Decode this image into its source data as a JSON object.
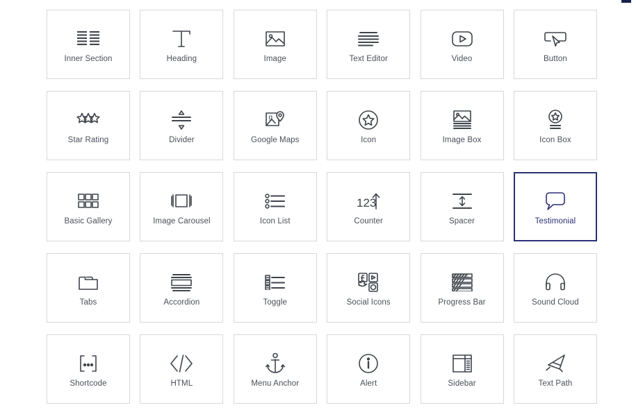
{
  "panel": {
    "title": "Elementor Widgets Panel",
    "background_color": "#ffffff",
    "card_border_color": "#d5d8dc",
    "selected_border_color": "#2b2f77",
    "icon_color": "#3f444b",
    "label_color": "#4a4f58",
    "corner_mark_color": "#18214d"
  },
  "widgets": [
    {
      "label": "Inner Section",
      "icon": "inner-section-icon",
      "selected": false
    },
    {
      "label": "Heading",
      "icon": "heading-t-icon",
      "selected": false
    },
    {
      "label": "Image",
      "icon": "image-icon",
      "selected": false
    },
    {
      "label": "Text Editor",
      "icon": "text-editor-icon",
      "selected": false
    },
    {
      "label": "Video",
      "icon": "video-play-icon",
      "selected": false
    },
    {
      "label": "Button",
      "icon": "button-cursor-icon",
      "selected": false
    },
    {
      "label": "Star Rating",
      "icon": "star-rating-icon",
      "selected": false
    },
    {
      "label": "Divider",
      "icon": "divider-icon",
      "selected": false
    },
    {
      "label": "Google Maps",
      "icon": "google-maps-icon",
      "selected": false
    },
    {
      "label": "Icon",
      "icon": "icon-circle-star-icon",
      "selected": false
    },
    {
      "label": "Image Box",
      "icon": "image-box-icon",
      "selected": false
    },
    {
      "label": "Icon Box",
      "icon": "icon-box-icon",
      "selected": false
    },
    {
      "label": "Basic Gallery",
      "icon": "basic-gallery-icon",
      "selected": false
    },
    {
      "label": "Image Carousel",
      "icon": "image-carousel-icon",
      "selected": false
    },
    {
      "label": "Icon List",
      "icon": "icon-list-icon",
      "selected": false
    },
    {
      "label": "Counter",
      "icon": "counter-123-icon",
      "selected": false
    },
    {
      "label": "Spacer",
      "icon": "spacer-icon",
      "selected": false
    },
    {
      "label": "Testimonial",
      "icon": "testimonial-quote-icon",
      "selected": true
    },
    {
      "label": "Tabs",
      "icon": "tabs-icon",
      "selected": false
    },
    {
      "label": "Accordion",
      "icon": "accordion-icon",
      "selected": false
    },
    {
      "label": "Toggle",
      "icon": "toggle-icon",
      "selected": false
    },
    {
      "label": "Social Icons",
      "icon": "social-icons-icon",
      "selected": false
    },
    {
      "label": "Progress Bar",
      "icon": "progress-bar-icon",
      "selected": false
    },
    {
      "label": "Sound Cloud",
      "icon": "headphones-icon",
      "selected": false
    },
    {
      "label": "Shortcode",
      "icon": "shortcode-brackets-icon",
      "selected": false
    },
    {
      "label": "HTML",
      "icon": "html-code-icon",
      "selected": false
    },
    {
      "label": "Menu Anchor",
      "icon": "anchor-icon",
      "selected": false
    },
    {
      "label": "Alert",
      "icon": "alert-info-icon",
      "selected": false
    },
    {
      "label": "Sidebar",
      "icon": "sidebar-layout-icon",
      "selected": false
    },
    {
      "label": "Text Path",
      "icon": "text-path-icon",
      "selected": false
    }
  ]
}
